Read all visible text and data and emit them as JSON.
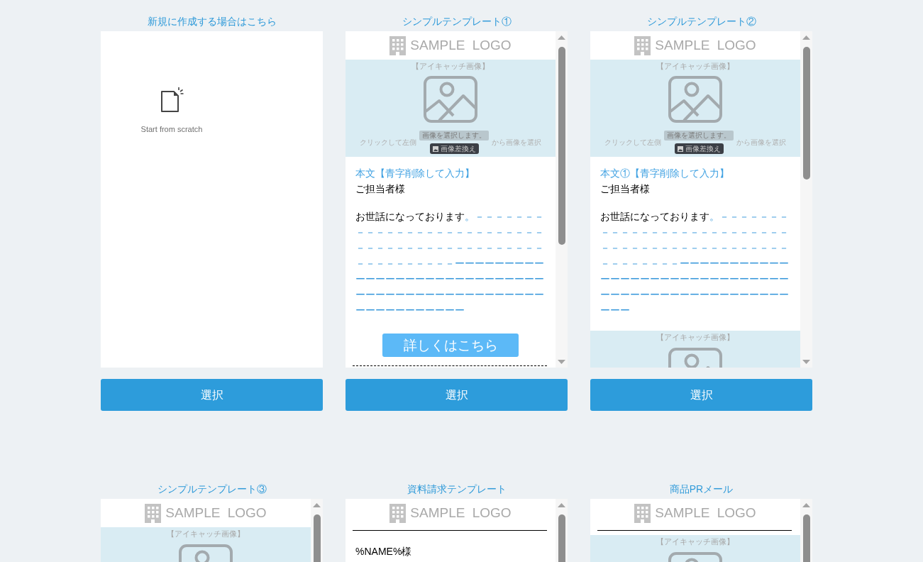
{
  "templates": [
    {
      "kind": "blank",
      "title": "新規に作成する場合はこちら",
      "caption": "Start from scratch",
      "button": "選択"
    },
    {
      "kind": "email",
      "title": "シンプルテンプレート①",
      "button": "選択",
      "blocks": [
        {
          "kind": "logo",
          "text": "SAMPLE LOGO"
        },
        {
          "kind": "eyecatch",
          "label": "【アイキャッチ画像】",
          "hint_left": "クリックして左側",
          "note": "画像を選択します。",
          "replace": "画像差換え",
          "hint_right": "から画像を選択"
        },
        {
          "kind": "body",
          "heading": "本文【青字削除して入力】",
          "salutation": "ご担当者様",
          "greeting": "お世話になっております",
          "filler": "。－－－－－－－－－－－－－－－－－－－－－－－－－－－－－－－－－－－－－－－－－－－－－－－－－－－－－－－ーーーーーーーーーーーーーーーーーーーーーーーーーーーーーーーーーーーーーーーーーーーーーーーーーーーーーーーーーー"
        },
        {
          "kind": "cta",
          "label": "詳しくはこちら"
        },
        {
          "kind": "dashed_rule"
        }
      ]
    },
    {
      "kind": "email",
      "title": "シンプルテンプレート②",
      "button": "選択",
      "blocks": [
        {
          "kind": "logo",
          "text": "SAMPLE LOGO"
        },
        {
          "kind": "eyecatch",
          "label": "【アイキャッチ画像】",
          "hint_left": "クリックして左側",
          "note": "画像を選択します。",
          "replace": "画像差換え",
          "hint_right": "から画像を選択"
        },
        {
          "kind": "body",
          "heading": "本文①【青字削除して入力】",
          "salutation": "ご担当者様",
          "greeting": "お世話になっております",
          "filler": "。－－－－－－－－－－－－－－－－－－－－－－－－－－－－－－－－－－－－－－－－－－－－－－－－－－－－－ーーーーーーーーーーーーーーーーーーーーーーーーーーーーーーーーーーーーーーーーーーーーーーーーーーーー"
        },
        {
          "kind": "eyecatch",
          "label": "【アイキャッチ画像】"
        }
      ]
    },
    {
      "kind": "email",
      "title": "シンプルテンプレート③",
      "blocks": [
        {
          "kind": "logo",
          "text": "SAMPLE LOGO"
        },
        {
          "kind": "eyecatch",
          "label": "【アイキャッチ画像】"
        }
      ]
    },
    {
      "kind": "email",
      "title": "資料請求テンプレート",
      "blocks": [
        {
          "kind": "logo",
          "text": "SAMPLE LOGO"
        },
        {
          "kind": "rule"
        },
        {
          "kind": "body",
          "salutation": "%NAME%様"
        }
      ]
    },
    {
      "kind": "email",
      "title": "商品PRメール",
      "blocks": [
        {
          "kind": "logo",
          "text": "SAMPLE LOGO"
        },
        {
          "kind": "rule"
        },
        {
          "kind": "eyecatch",
          "label": "【アイキャッチ画像】"
        }
      ]
    }
  ]
}
